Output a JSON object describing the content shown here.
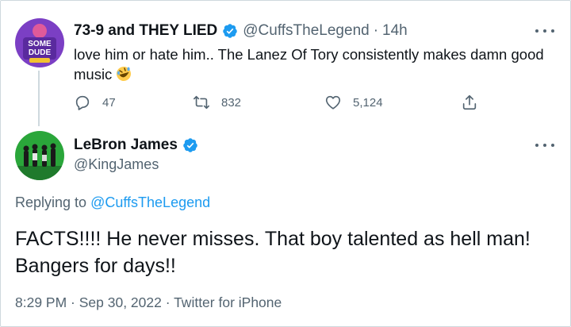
{
  "tweet1": {
    "display_name": "73-9 and THEY LIED",
    "handle": "@CuffsTheLegend",
    "separator": "·",
    "time": "14h",
    "text": "love him or hate him.. The Lanez Of Tory consistently makes damn good music",
    "emoji_icon": "rolling-on-the-floor-laughing-emoji",
    "avatar_text_top": "SOME",
    "avatar_text_bottom": "DUDE",
    "reply_count": "47",
    "retweet_count": "832",
    "like_count": "5,124"
  },
  "tweet2": {
    "display_name": "LeBron James",
    "handle": "@KingJames",
    "replying_prefix": "Replying to",
    "replying_to": "@CuffsTheLegend",
    "text": "FACTS!!!! He never misses. That boy talented as hell man! Bangers for days!!",
    "timestamp": "8:29 PM · Sep 30, 2022 · Twitter for iPhone"
  },
  "colors": {
    "accent": "#1d9bf0",
    "text": "#0f1419",
    "secondary": "#536471",
    "border": "#cfd9de",
    "avatar1_bg": "#7b3fc4",
    "avatar2_bg": "#2aa63a"
  }
}
